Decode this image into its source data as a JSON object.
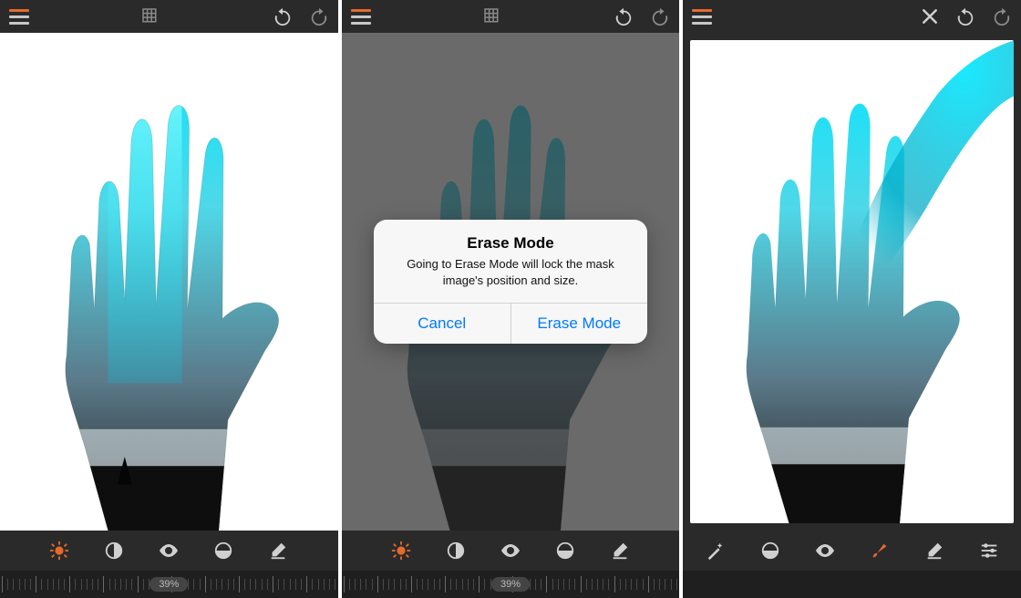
{
  "screens": {
    "s1": {
      "toolbar": {
        "has_grid": true,
        "has_close": false
      },
      "ruler_value": "39%",
      "tools_variant": "edit"
    },
    "s2": {
      "toolbar": {
        "has_grid": true,
        "has_close": false
      },
      "ruler_value": "39%",
      "tools_variant": "edit",
      "dialog": {
        "title": "Erase Mode",
        "message": "Going to Erase Mode will lock the mask image's position and size.",
        "cancel": "Cancel",
        "confirm": "Erase Mode"
      }
    },
    "s3": {
      "toolbar": {
        "has_grid": false,
        "has_close": true
      },
      "tools_variant": "erase"
    }
  },
  "icons": {
    "menu": "menu-icon",
    "grid": "grid-icon",
    "undo": "undo-icon",
    "redo": "redo-icon",
    "close": "close-icon",
    "brightness": "brightness-icon",
    "contrast": "contrast-icon",
    "eye": "eye-icon",
    "blend": "blend-icon",
    "eraser": "eraser-icon",
    "wand": "wand-icon",
    "mask": "mask-icon",
    "brush": "brush-icon",
    "sliders": "sliders-icon"
  },
  "colors": {
    "accent": "#e46a2e",
    "blue": "#007aff"
  }
}
